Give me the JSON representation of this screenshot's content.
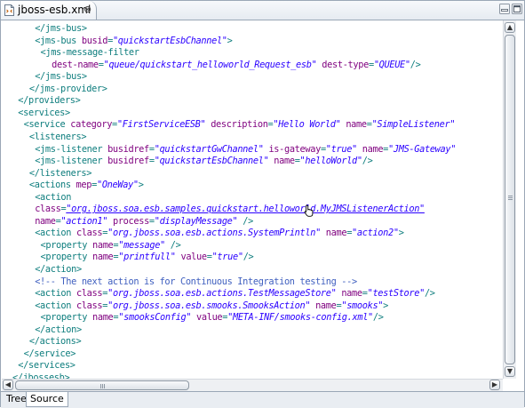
{
  "editor": {
    "tab_title": "jboss-esb.xml",
    "tab_icon": "xml-file-icon",
    "close_glyph": "⊗"
  },
  "colors": {
    "tag": "#0f7e7e",
    "attribute_name": "#7f007f",
    "attribute_value": "#2a00ff",
    "comment": "#3f5fbf"
  },
  "source_lines": [
    {
      "indent": 4,
      "segs": [
        {
          "t": "</jms-bus>",
          "c": "tg"
        }
      ]
    },
    {
      "indent": 4,
      "segs": [
        {
          "t": "<jms-bus ",
          "c": "tg"
        },
        {
          "t": "busid",
          "c": "an"
        },
        {
          "t": "=",
          "c": "tg"
        },
        {
          "t": "\"quickstartEsbChannel\"",
          "c": "av"
        },
        {
          "t": ">",
          "c": "tg"
        }
      ]
    },
    {
      "indent": 5,
      "segs": [
        {
          "t": "<jms-message-filter",
          "c": "tg"
        }
      ]
    },
    {
      "indent": 7,
      "segs": [
        {
          "t": "dest-name",
          "c": "an"
        },
        {
          "t": "=",
          "c": "tg"
        },
        {
          "t": "\"queue/quickstart_helloworld_Request_esb\"",
          "c": "av"
        },
        {
          "t": " ",
          "c": "tg"
        },
        {
          "t": "dest-type",
          "c": "an"
        },
        {
          "t": "=",
          "c": "tg"
        },
        {
          "t": "\"QUEUE\"",
          "c": "av"
        },
        {
          "t": "/>",
          "c": "tg"
        }
      ]
    },
    {
      "indent": 4,
      "segs": [
        {
          "t": "</jms-bus>",
          "c": "tg"
        }
      ]
    },
    {
      "indent": 3,
      "segs": [
        {
          "t": "</jms-provider>",
          "c": "tg"
        }
      ]
    },
    {
      "indent": 1,
      "segs": [
        {
          "t": "</providers>",
          "c": "tg"
        }
      ]
    },
    {
      "indent": 1,
      "segs": [
        {
          "t": "<services>",
          "c": "tg"
        }
      ]
    },
    {
      "indent": 2,
      "segs": [
        {
          "t": "<service ",
          "c": "tg"
        },
        {
          "t": "category",
          "c": "an"
        },
        {
          "t": "=",
          "c": "tg"
        },
        {
          "t": "\"FirstServiceESB\"",
          "c": "av"
        },
        {
          "t": " ",
          "c": "tg"
        },
        {
          "t": "description",
          "c": "an"
        },
        {
          "t": "=",
          "c": "tg"
        },
        {
          "t": "\"Hello World\"",
          "c": "av"
        },
        {
          "t": " ",
          "c": "tg"
        },
        {
          "t": "name",
          "c": "an"
        },
        {
          "t": "=",
          "c": "tg"
        },
        {
          "t": "\"SimpleListener\"",
          "c": "av"
        }
      ]
    },
    {
      "indent": 3,
      "segs": [
        {
          "t": "<listeners>",
          "c": "tg"
        }
      ]
    },
    {
      "indent": 4,
      "segs": [
        {
          "t": "<jms-listener ",
          "c": "tg"
        },
        {
          "t": "busidref",
          "c": "an"
        },
        {
          "t": "=",
          "c": "tg"
        },
        {
          "t": "\"quickstartGwChannel\"",
          "c": "av"
        },
        {
          "t": " ",
          "c": "tg"
        },
        {
          "t": "is-gateway",
          "c": "an"
        },
        {
          "t": "=",
          "c": "tg"
        },
        {
          "t": "\"true\"",
          "c": "av"
        },
        {
          "t": " ",
          "c": "tg"
        },
        {
          "t": "name",
          "c": "an"
        },
        {
          "t": "=",
          "c": "tg"
        },
        {
          "t": "\"JMS-Gateway\"",
          "c": "av"
        }
      ]
    },
    {
      "indent": 4,
      "segs": [
        {
          "t": "<jms-listener ",
          "c": "tg"
        },
        {
          "t": "busidref",
          "c": "an"
        },
        {
          "t": "=",
          "c": "tg"
        },
        {
          "t": "\"quickstartEsbChannel\"",
          "c": "av"
        },
        {
          "t": " ",
          "c": "tg"
        },
        {
          "t": "name",
          "c": "an"
        },
        {
          "t": "=",
          "c": "tg"
        },
        {
          "t": "\"helloWorld\"",
          "c": "av"
        },
        {
          "t": "/>",
          "c": "tg"
        }
      ]
    },
    {
      "indent": 3,
      "segs": [
        {
          "t": "</listeners>",
          "c": "tg"
        }
      ]
    },
    {
      "indent": 3,
      "segs": [
        {
          "t": "<actions ",
          "c": "tg"
        },
        {
          "t": "mep",
          "c": "an"
        },
        {
          "t": "=",
          "c": "tg"
        },
        {
          "t": "\"OneWay\"",
          "c": "av"
        },
        {
          "t": ">",
          "c": "tg"
        }
      ]
    },
    {
      "indent": 4,
      "segs": [
        {
          "t": "<action",
          "c": "tg"
        }
      ]
    },
    {
      "indent": 4,
      "segs": [
        {
          "t": "class",
          "c": "an"
        },
        {
          "t": "=",
          "c": "tg"
        },
        {
          "t": "\"org.jboss.soa.esb.samples.quickstart.helloworld.MyJMSListenerAction\"",
          "c": "av hover-val"
        }
      ]
    },
    {
      "indent": 4,
      "segs": [
        {
          "t": "name",
          "c": "an"
        },
        {
          "t": "=",
          "c": "tg"
        },
        {
          "t": "\"action1\"",
          "c": "av"
        },
        {
          "t": " ",
          "c": "tg"
        },
        {
          "t": "process",
          "c": "an"
        },
        {
          "t": "=",
          "c": "tg"
        },
        {
          "t": "\"displayMessage\"",
          "c": "av"
        },
        {
          "t": " />",
          "c": "tg"
        }
      ]
    },
    {
      "indent": 4,
      "segs": [
        {
          "t": "<action ",
          "c": "tg"
        },
        {
          "t": "class",
          "c": "an"
        },
        {
          "t": "=",
          "c": "tg"
        },
        {
          "t": "\"org.jboss.soa.esb.actions.SystemPrintln\"",
          "c": "av"
        },
        {
          "t": " ",
          "c": "tg"
        },
        {
          "t": "name",
          "c": "an"
        },
        {
          "t": "=",
          "c": "tg"
        },
        {
          "t": "\"action2\"",
          "c": "av"
        },
        {
          "t": ">",
          "c": "tg"
        }
      ]
    },
    {
      "indent": 5,
      "segs": [
        {
          "t": "<property ",
          "c": "tg"
        },
        {
          "t": "name",
          "c": "an"
        },
        {
          "t": "=",
          "c": "tg"
        },
        {
          "t": "\"message\"",
          "c": "av"
        },
        {
          "t": " />",
          "c": "tg"
        }
      ]
    },
    {
      "indent": 5,
      "segs": [
        {
          "t": "<property ",
          "c": "tg"
        },
        {
          "t": "name",
          "c": "an"
        },
        {
          "t": "=",
          "c": "tg"
        },
        {
          "t": "\"printfull\"",
          "c": "av"
        },
        {
          "t": " ",
          "c": "tg"
        },
        {
          "t": "value",
          "c": "an"
        },
        {
          "t": "=",
          "c": "tg"
        },
        {
          "t": "\"true\"",
          "c": "av"
        },
        {
          "t": "/>",
          "c": "tg"
        }
      ]
    },
    {
      "indent": 4,
      "segs": [
        {
          "t": "</action>",
          "c": "tg"
        }
      ]
    },
    {
      "indent": 4,
      "segs": [
        {
          "t": "<!-- The next action is for Continuous Integration testing -->",
          "c": "cm"
        }
      ]
    },
    {
      "indent": 4,
      "segs": [
        {
          "t": "<action ",
          "c": "tg"
        },
        {
          "t": "class",
          "c": "an"
        },
        {
          "t": "=",
          "c": "tg"
        },
        {
          "t": "\"org.jboss.soa.esb.actions.TestMessageStore\"",
          "c": "av"
        },
        {
          "t": " ",
          "c": "tg"
        },
        {
          "t": "name",
          "c": "an"
        },
        {
          "t": "=",
          "c": "tg"
        },
        {
          "t": "\"testStore\"",
          "c": "av"
        },
        {
          "t": "/>",
          "c": "tg"
        }
      ]
    },
    {
      "indent": 4,
      "segs": [
        {
          "t": "<action ",
          "c": "tg"
        },
        {
          "t": "class",
          "c": "an"
        },
        {
          "t": "=",
          "c": "tg"
        },
        {
          "t": "\"org.jboss.soa.esb.smooks.SmooksAction\"",
          "c": "av"
        },
        {
          "t": " ",
          "c": "tg"
        },
        {
          "t": "name",
          "c": "an"
        },
        {
          "t": "=",
          "c": "tg"
        },
        {
          "t": "\"smooks\"",
          "c": "av"
        },
        {
          "t": ">",
          "c": "tg"
        }
      ]
    },
    {
      "indent": 5,
      "segs": [
        {
          "t": "<property ",
          "c": "tg"
        },
        {
          "t": "name",
          "c": "an"
        },
        {
          "t": "=",
          "c": "tg"
        },
        {
          "t": "\"smooksConfig\"",
          "c": "av"
        },
        {
          "t": " ",
          "c": "tg"
        },
        {
          "t": "value",
          "c": "an"
        },
        {
          "t": "=",
          "c": "tg"
        },
        {
          "t": "\"META-INF/smooks-config.xml\"",
          "c": "av"
        },
        {
          "t": "/>",
          "c": "tg"
        }
      ]
    },
    {
      "indent": 4,
      "segs": [
        {
          "t": "</action>",
          "c": "tg"
        }
      ]
    },
    {
      "indent": 3,
      "segs": [
        {
          "t": "</actions>",
          "c": "tg"
        }
      ]
    },
    {
      "indent": 2,
      "segs": [
        {
          "t": "</service>",
          "c": "tg"
        }
      ]
    },
    {
      "indent": 1,
      "segs": [
        {
          "t": "</services>",
          "c": "tg"
        }
      ]
    },
    {
      "indent": 0,
      "segs": [
        {
          "t": "</jbossesb>",
          "c": "tg"
        }
      ]
    }
  ],
  "bottom_tabs": [
    {
      "label": "Tree",
      "active": false
    },
    {
      "label": "Source",
      "active": true
    }
  ]
}
